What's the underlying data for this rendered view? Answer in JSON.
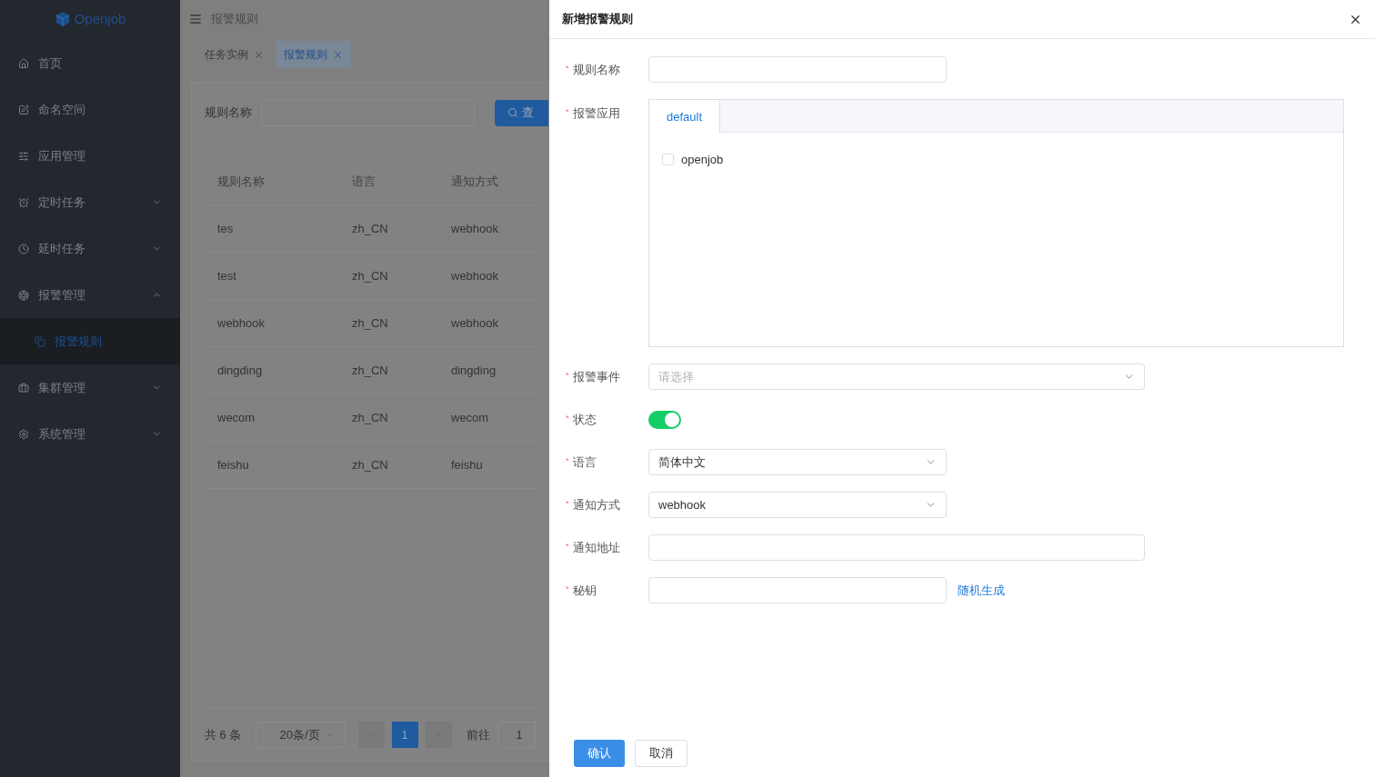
{
  "sidebar": {
    "logo": "Openjob",
    "items": [
      {
        "label": "首页",
        "kind": "link",
        "selected": false
      },
      {
        "label": "命名空间",
        "kind": "link",
        "selected": false
      },
      {
        "label": "应用管理",
        "kind": "link",
        "selected": false
      },
      {
        "label": "定时任务",
        "kind": "group",
        "expanded": false,
        "selected": false
      },
      {
        "label": "延时任务",
        "kind": "group",
        "expanded": false,
        "selected": false
      },
      {
        "label": "报警管理",
        "kind": "group",
        "expanded": true,
        "selected": false,
        "children": [
          {
            "label": "报警规则",
            "selected": true
          }
        ]
      },
      {
        "label": "集群管理",
        "kind": "group",
        "expanded": false,
        "selected": false
      },
      {
        "label": "系统管理",
        "kind": "group",
        "expanded": false,
        "selected": false
      }
    ]
  },
  "header": {
    "breadcrumb": "报警规则"
  },
  "tabs": [
    {
      "label": "任务实例",
      "selected": false
    },
    {
      "label": "报警规则",
      "selected": true
    }
  ],
  "search": {
    "label": "规则名称",
    "button": "查"
  },
  "table": {
    "columns": [
      "规则名称",
      "语言",
      "通知方式"
    ],
    "rows": [
      [
        "tes",
        "zh_CN",
        "webhook"
      ],
      [
        "test",
        "zh_CN",
        "webhook"
      ],
      [
        "webhook",
        "zh_CN",
        "webhook"
      ],
      [
        "dingding",
        "zh_CN",
        "dingding"
      ],
      [
        "wecom",
        "zh_CN",
        "wecom"
      ],
      [
        "feishu",
        "zh_CN",
        "feishu"
      ]
    ]
  },
  "pagination": {
    "total": "共 6 条",
    "page_size": "20条/页",
    "pages": [
      {
        "label": "1",
        "selected": true
      }
    ],
    "goto": "前往",
    "goto_value": "1"
  },
  "drawer": {
    "title": "新增报警规则",
    "fields": [
      {
        "kind": "text",
        "label": "规则名称",
        "marker": "*",
        "wide": false
      },
      {
        "kind": "apps",
        "label": "报警应用",
        "marker": "*",
        "tabs": [
          {
            "label": "default",
            "selected": true
          }
        ],
        "options": [
          {
            "label": "openjob",
            "checked": false
          }
        ]
      },
      {
        "kind": "select",
        "label": "报警事件",
        "marker": "*",
        "wide": true,
        "placeholder": "请选择"
      },
      {
        "kind": "switch",
        "label": "状态",
        "marker": "*",
        "on": true
      },
      {
        "kind": "select",
        "label": "语言",
        "marker": "*",
        "wide": false,
        "value": "简体中文"
      },
      {
        "kind": "select",
        "label": "通知方式",
        "marker": "*",
        "wide": false,
        "value": "webhook"
      },
      {
        "kind": "text",
        "label": "通知地址",
        "marker": "*",
        "wide": true
      },
      {
        "kind": "text",
        "label": "秘钥",
        "marker": "*",
        "wide": false,
        "link": "随机生成"
      }
    ],
    "buttons": [
      {
        "label": "确认",
        "kind": "primary"
      },
      {
        "label": "取消",
        "kind": "default"
      }
    ]
  }
}
